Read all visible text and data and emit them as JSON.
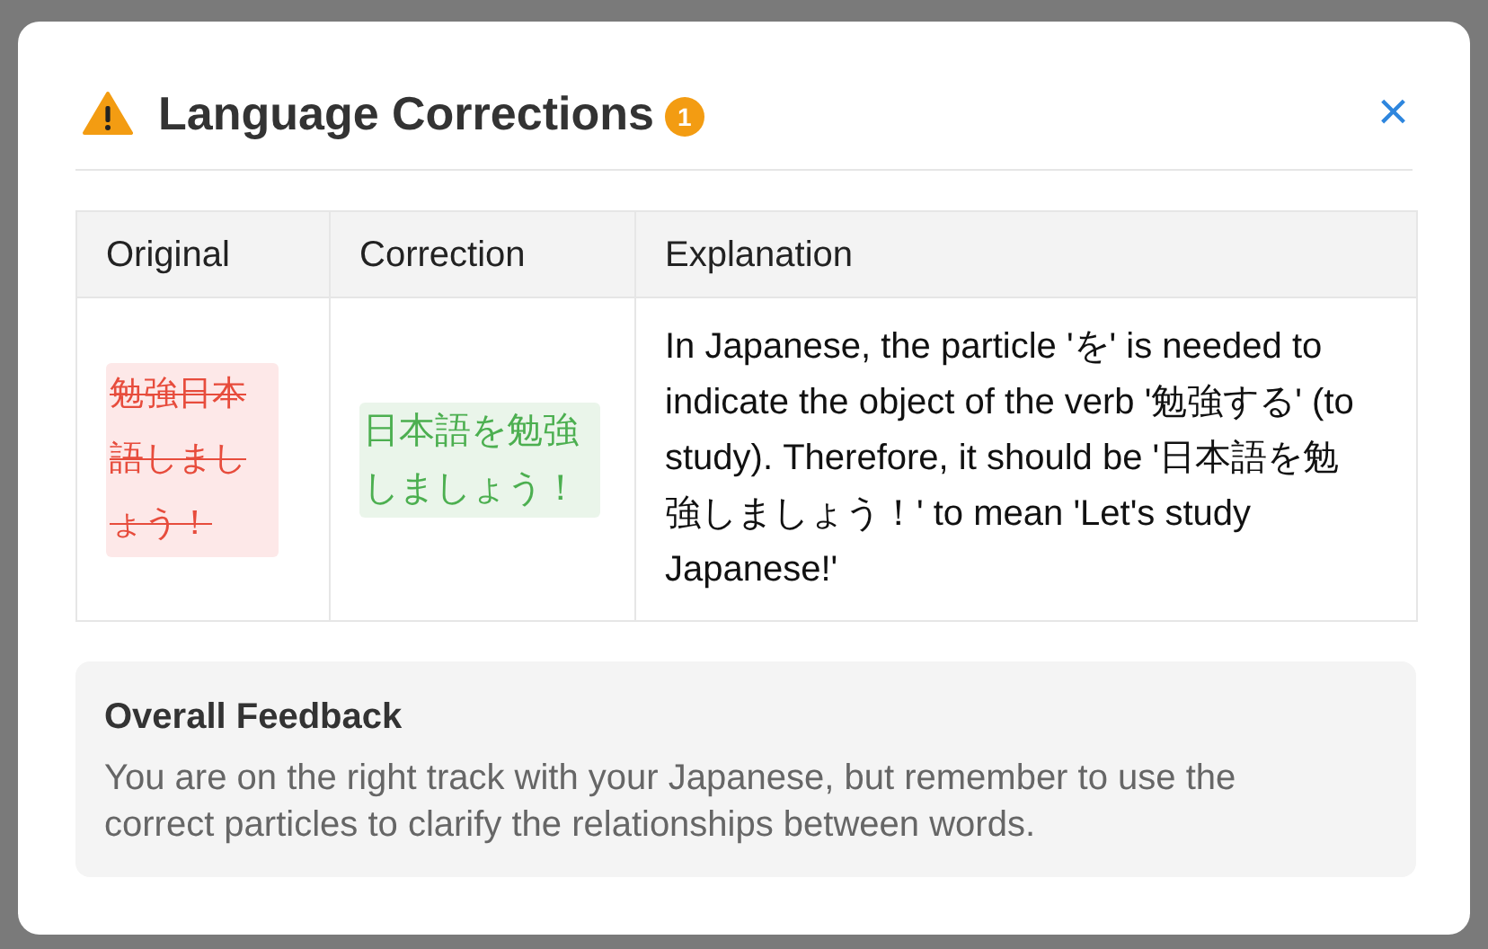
{
  "dialog": {
    "title": "Language Corrections",
    "badge": "1",
    "close": "×"
  },
  "table": {
    "columns": [
      "Original",
      "Correction",
      "Explanation"
    ],
    "rows": [
      {
        "original": "勉強日本語しましょう！",
        "correction": "日本語を勉強しましょう！",
        "explanation": "In Japanese, the particle 'を' is needed to indicate the object of the verb '勉強する' (to study). Therefore, it should be '日本語を勉強しましょう！' to mean 'Let's study Japanese!'"
      }
    ]
  },
  "feedback": {
    "title": "Overall Feedback",
    "text": "You are on the right track with your Japanese, but remember to use the correct particles to clarify the relationships between words."
  }
}
